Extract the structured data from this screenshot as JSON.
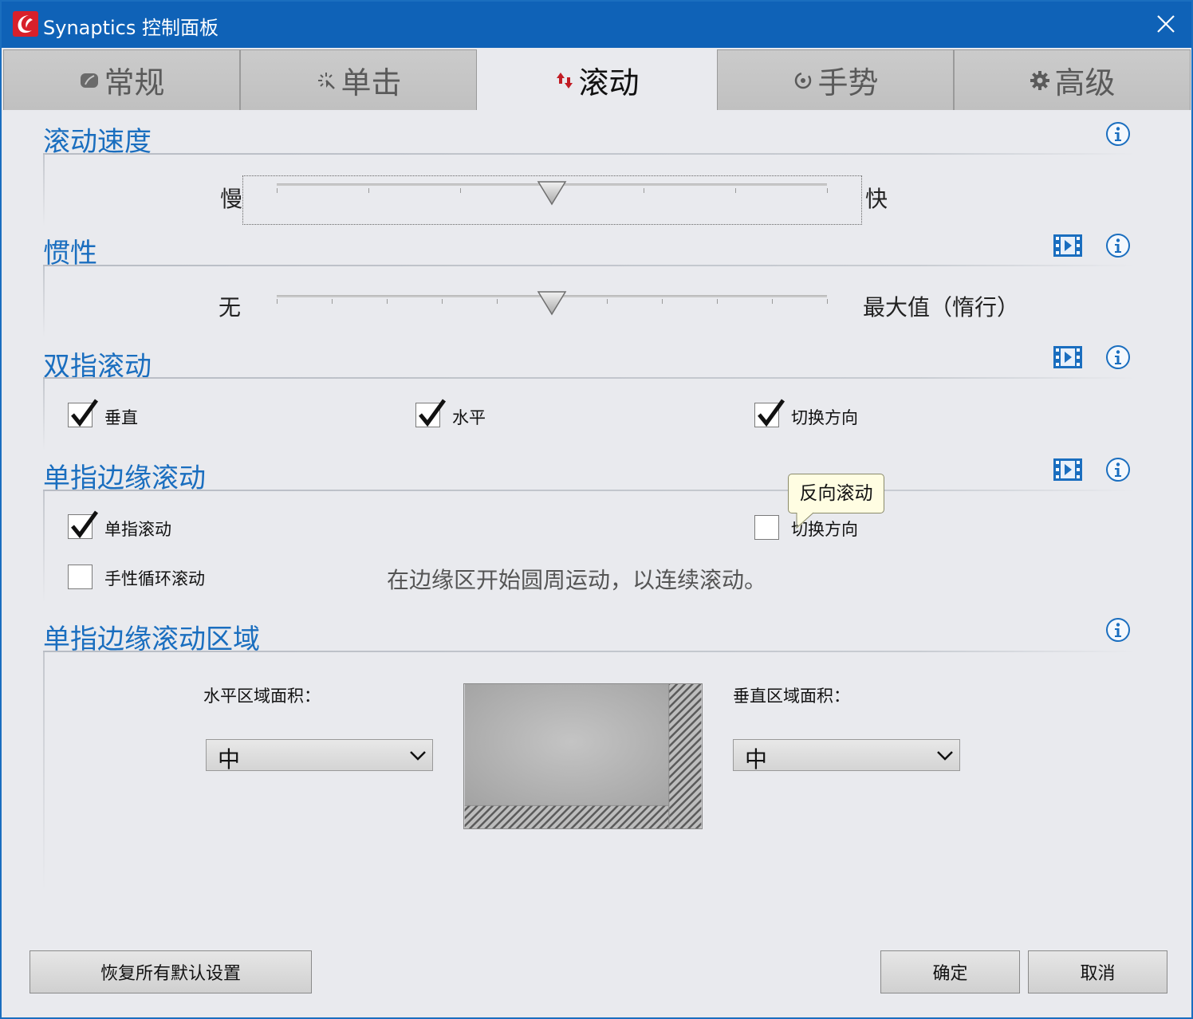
{
  "window": {
    "title": "Synaptics 控制面板",
    "accent": "#0f62b7",
    "heading_color": "#1a6ebf"
  },
  "tabs": [
    {
      "label": "常规",
      "icon": "touchpad-icon",
      "active": false
    },
    {
      "label": "单击",
      "icon": "click-icon",
      "active": false
    },
    {
      "label": "滚动",
      "icon": "scroll-arrows-icon",
      "active": true
    },
    {
      "label": "手势",
      "icon": "gesture-icon",
      "active": false
    },
    {
      "label": "高级",
      "icon": "gear-icon",
      "active": false
    }
  ],
  "scroll_speed": {
    "title": "滚动速度",
    "min_label": "慢",
    "max_label": "快",
    "value_fraction": 0.5
  },
  "inertia": {
    "title": "惯性",
    "min_label": "无",
    "max_label": "最大值（惰行）",
    "value_fraction": 0.5
  },
  "two_finger": {
    "title": "双指滚动",
    "options": [
      {
        "label": "垂直",
        "checked": true
      },
      {
        "label": "水平",
        "checked": true
      },
      {
        "label": "切换方向",
        "checked": true
      }
    ]
  },
  "edge_scroll": {
    "title": "单指边缘滚动",
    "single_finger": {
      "label": "单指滚动",
      "checked": true
    },
    "reverse": {
      "label": "切换方向",
      "checked": false
    },
    "chiral": {
      "label": "手性循环滚动",
      "checked": false
    },
    "chiral_hint": "在边缘区开始圆周运动，以连续滚动。",
    "tooltip": "反向滚动"
  },
  "edge_zone": {
    "title": "单指边缘滚动区域",
    "horizontal_label": "水平区域面积：",
    "horizontal_value": "中",
    "vertical_label": "垂直区域面积：",
    "vertical_value": "中"
  },
  "footer": {
    "restore_label": "恢复所有默认设置",
    "ok_label": "确定",
    "cancel_label": "取消"
  }
}
